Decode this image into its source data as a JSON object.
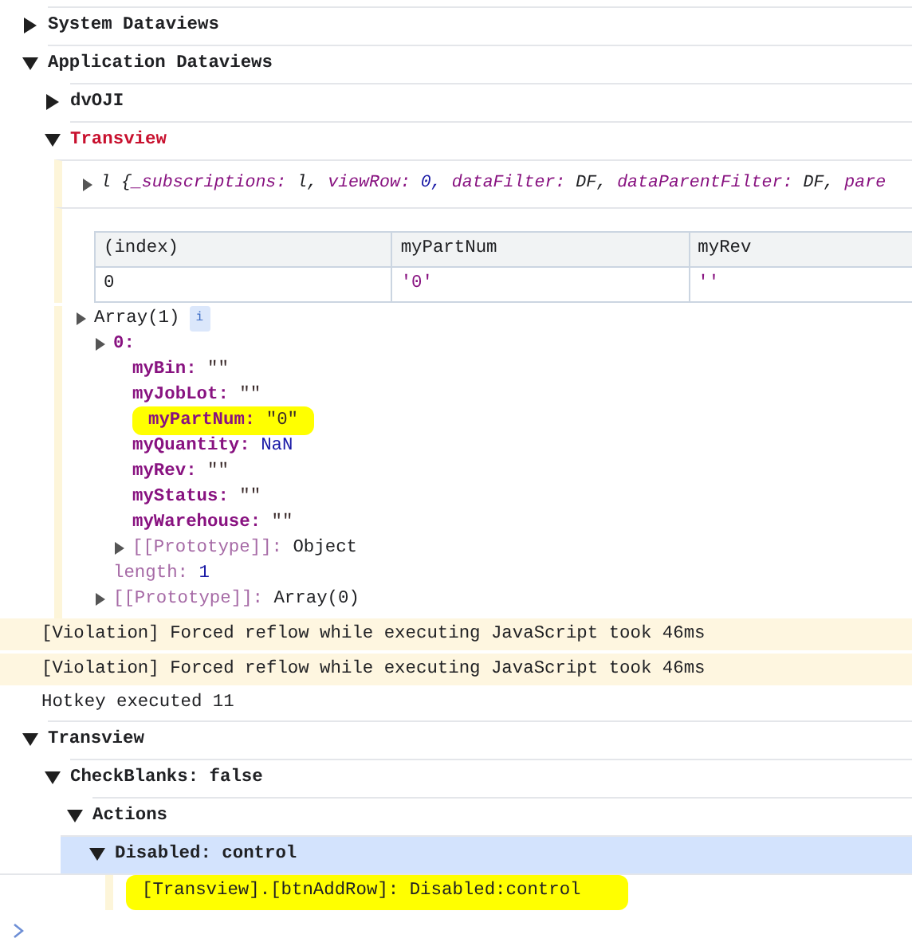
{
  "console": [
    {
      "kind": "group",
      "label": "System Dataviews",
      "expanded": false
    },
    {
      "kind": "group",
      "label": "Application Dataviews",
      "expanded": true,
      "children": [
        {
          "kind": "group",
          "label": "dvOJI",
          "expanded": false
        },
        {
          "kind": "group",
          "label": "Transview",
          "expanded": true,
          "color": "#c8102e",
          "children": [
            {
              "kind": "object",
              "expanded": false,
              "class_name": "l {",
              "props": [
                {
                  "key": "_subscriptions:",
                  "value": "l,",
                  "kind": "object"
                },
                {
                  "key": "viewRow:",
                  "value": "0,",
                  "kind": "number"
                },
                {
                  "key": "dataFilter:",
                  "value": "DF,",
                  "kind": "object"
                },
                {
                  "key": "dataParentFilter:",
                  "value": "DF,",
                  "kind": "object"
                },
                {
                  "key": "pare"
                }
              ]
            },
            {
              "kind": "table",
              "columns": [
                "(index)",
                "myPartNum",
                "myRev"
              ],
              "rows": [
                [
                  "0",
                  "'0'",
                  "''"
                ]
              ]
            },
            {
              "kind": "tree",
              "nodes": [
                {
                  "label": "Array(1)",
                  "info": "i",
                  "expanded": false,
                  "children": [
                    {
                      "key": "0:",
                      "expanded": false,
                      "children": [
                        {
                          "key": "myBin:",
                          "value": "\"\"",
                          "kind": "string"
                        },
                        {
                          "key": "myJobLot:",
                          "value": "\"\"",
                          "kind": "string"
                        },
                        {
                          "key": "myPartNum:",
                          "value": "\"0\"",
                          "kind": "string",
                          "highlighted": true
                        },
                        {
                          "key": "myQuantity:",
                          "value": "NaN",
                          "kind": "number"
                        },
                        {
                          "key": "myRev:",
                          "value": "\"\"",
                          "kind": "string"
                        },
                        {
                          "key": "myStatus:",
                          "value": "\"\"",
                          "kind": "string"
                        },
                        {
                          "key": "myWarehouse:",
                          "value": "\"\"",
                          "kind": "string"
                        },
                        {
                          "key": "[[Prototype]]:",
                          "value": "Object",
                          "kind": "object",
                          "dim": true,
                          "expanded": false
                        }
                      ]
                    },
                    {
                      "key": "length:",
                      "value": "1",
                      "kind": "number",
                      "dim": true
                    },
                    {
                      "key": "[[Prototype]]:",
                      "value": "Array(0)",
                      "kind": "object",
                      "dim": true,
                      "expanded": false
                    }
                  ]
                }
              ]
            }
          ]
        }
      ]
    },
    {
      "kind": "violation",
      "text": "[Violation] Forced reflow while executing JavaScript took 46ms"
    },
    {
      "kind": "violation",
      "text": "[Violation] Forced reflow while executing JavaScript took 46ms"
    },
    {
      "kind": "log",
      "text": "Hotkey executed 11"
    },
    {
      "kind": "group",
      "label": "Transview",
      "expanded": true,
      "children": [
        {
          "kind": "group",
          "label": "CheckBlanks: false",
          "expanded": true,
          "children": [
            {
              "kind": "group",
              "label": "Actions",
              "expanded": true,
              "children": [
                {
                  "kind": "group",
                  "label": "Disabled: control",
                  "expanded": true,
                  "selected": true,
                  "children": [
                    {
                      "kind": "log",
                      "text": "[Transview].[btnAddRow]: Disabled:control",
                      "highlighted": true
                    }
                  ]
                }
              ]
            }
          ]
        }
      ]
    }
  ]
}
